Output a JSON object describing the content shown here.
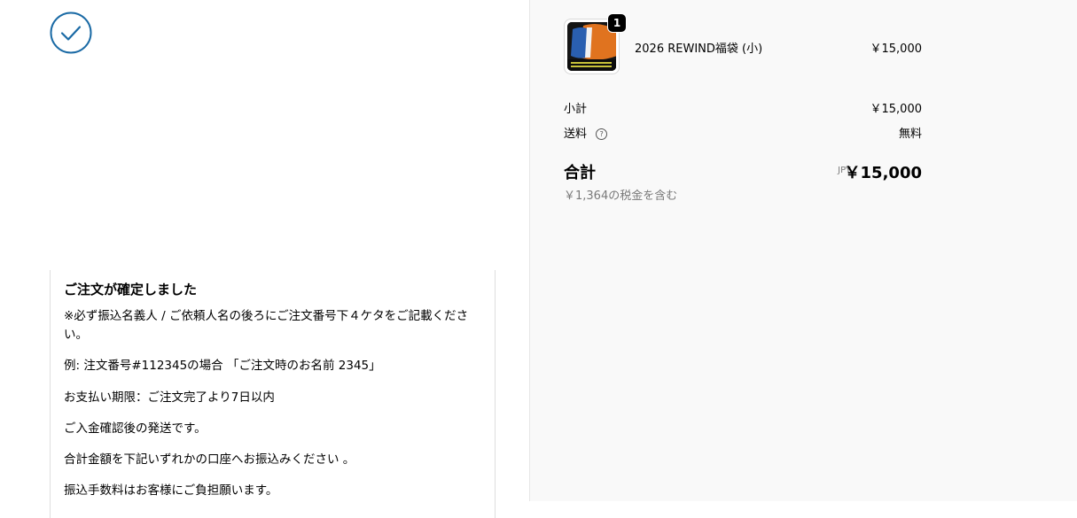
{
  "confirmation": {
    "title": "ご注文が確定しました",
    "lines": [
      "※必ず振込名義人 / ご依頼人名の後ろにご注文番号下４ケタをご記載ください。",
      "例: 注文番号#112345の場合 「ご注文時のお名前 2345」",
      "お支払い期限：ご注文完了より7日以内",
      "ご入金確認後の発送です。",
      "合計金額を下記いずれかの口座へお振込みください 。",
      "振込手数料はお客様にご負担願います。"
    ]
  },
  "order_summary": {
    "item": {
      "name": "2026 REWIND福袋 (小)",
      "price": "￥15,000",
      "quantity": "1"
    },
    "subtotal_label": "小計",
    "subtotal_value": "￥15,000",
    "shipping_label": "送料",
    "shipping_value": "無料",
    "total_label": "合計",
    "currency": "JPY",
    "total_value": "￥15,000",
    "tax_note": "￥1,364の税金を含む"
  },
  "colors": {
    "accent": "#1a6aa5",
    "sidebar_bg": "#f9f9f9"
  }
}
